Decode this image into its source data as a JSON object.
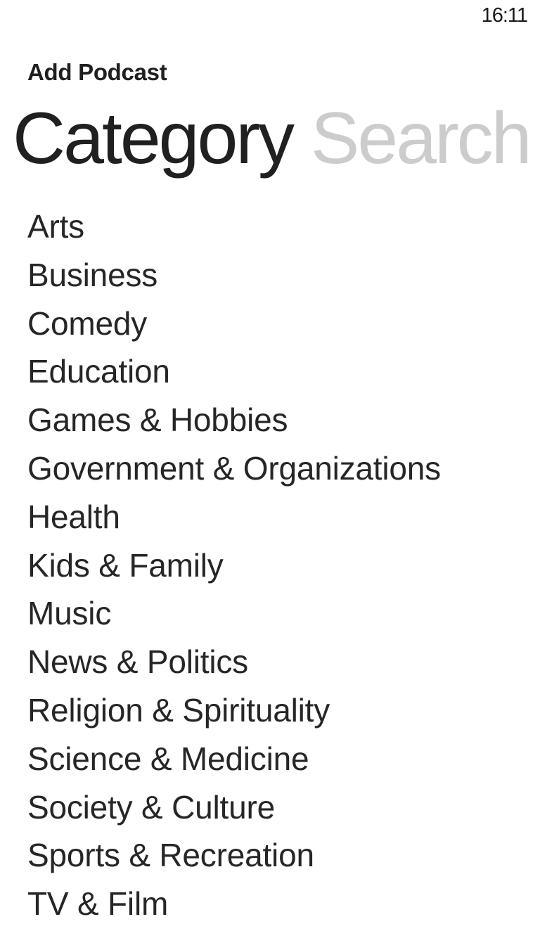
{
  "status_bar": {
    "time": "16:11"
  },
  "app": {
    "title": "Add Podcast"
  },
  "pivot": {
    "headers": [
      {
        "label": "Category",
        "active": true
      },
      {
        "label": "Search",
        "active": false
      }
    ]
  },
  "categories": [
    "Arts",
    "Business",
    "Comedy",
    "Education",
    "Games & Hobbies",
    "Government & Organizations",
    "Health",
    "Kids & Family",
    "Music",
    "News & Politics",
    "Religion & Spirituality",
    "Science & Medicine",
    "Society & Culture",
    "Sports & Recreation",
    "TV & Film"
  ],
  "colors": {
    "text_primary": "#1f1f1f",
    "pivot_inactive": "#cccccc",
    "background": "#ffffff"
  }
}
